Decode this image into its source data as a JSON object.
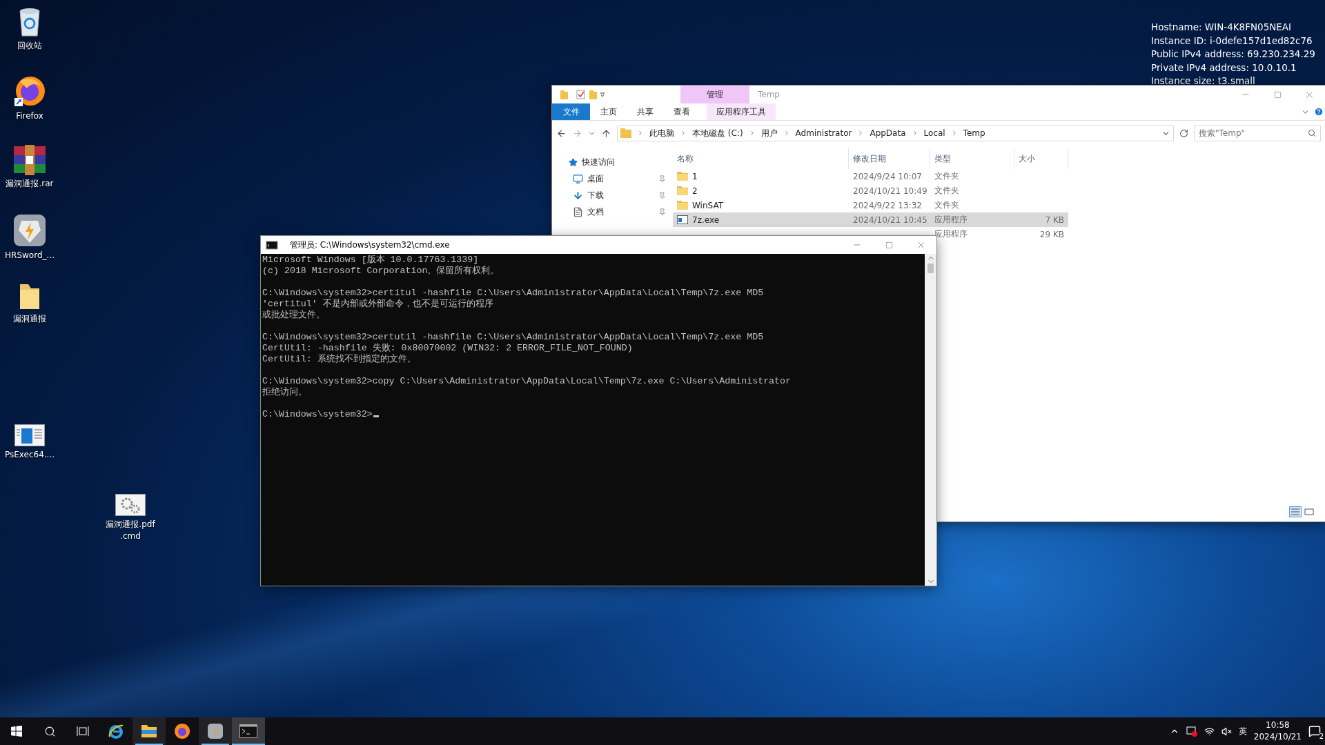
{
  "desktop_icons": [
    {
      "kind": "recycle",
      "label": "回收站"
    },
    {
      "kind": "firefox",
      "label": "Firefox"
    },
    {
      "kind": "rar",
      "label": "漏洞通报.rar"
    },
    {
      "kind": "hrsword",
      "label": "HRSword_..."
    },
    {
      "kind": "folder",
      "label": "漏洞通报"
    },
    {
      "kind": "app",
      "label": "PsExec64...."
    },
    {
      "kind": "script",
      "label": "漏洞通报.pdf .cmd"
    }
  ],
  "instance_info": [
    "Hostname: WIN-4K8FN05NEAI",
    "Instance ID: i-0defe157d1ed82c76",
    "Public IPv4 address: 69.230.234.29",
    "Private IPv4 address: 10.0.10.1",
    "Instance size: t3.small"
  ],
  "explorer": {
    "context_tab": "管理",
    "title": "Temp",
    "ribbon_tabs": [
      {
        "kind": "file",
        "label": "文件"
      },
      {
        "kind": "tab",
        "label": "主页"
      },
      {
        "kind": "tab",
        "label": "共享"
      },
      {
        "kind": "tab",
        "label": "查看"
      },
      {
        "kind": "context",
        "label": "应用程序工具"
      }
    ],
    "breadcrumbs": [
      "此电脑",
      "本地磁盘 (C:)",
      "用户",
      "Administrator",
      "AppData",
      "Local",
      "Temp"
    ],
    "search": {
      "placeholder": "搜索\"Temp\""
    },
    "nav": [
      {
        "kind": "star",
        "label": "快速访问"
      },
      {
        "kind": "desktop",
        "label": "桌面",
        "pinned": true
      },
      {
        "kind": "download",
        "label": "下载",
        "pinned": true
      },
      {
        "kind": "docs",
        "label": "文档",
        "pinned": true
      }
    ],
    "columns": [
      "名称",
      "修改日期",
      "类型",
      "大小"
    ],
    "rows": [
      {
        "kind": "folder",
        "name": "1",
        "date": "2024/9/24 10:07",
        "type": "文件夹",
        "selected": false
      },
      {
        "kind": "folder",
        "name": "2",
        "date": "2024/10/21 10:49",
        "type": "文件夹",
        "selected": false
      },
      {
        "kind": "folder",
        "name": "WinSAT",
        "date": "2024/9/22 13:32",
        "type": "文件夹",
        "selected": false
      },
      {
        "kind": "exe",
        "name": "7z.exe",
        "date": "2024/10/21 10:45",
        "type": "应用程序",
        "size": "7 KB",
        "selected": true
      },
      {
        "kind": "hidden",
        "type": "应用程序",
        "size": "29 KB",
        "selected": false
      }
    ]
  },
  "console": {
    "title": "管理员: C:\\Windows\\system32\\cmd.exe",
    "blocks": [
      [
        "Microsoft Windows [版本 10.0.17763.1339]",
        "(c) 2018 Microsoft Corporation。保留所有权利。"
      ],
      [
        "C:\\Windows\\system32>certitul -hashfile C:\\Users\\Administrator\\AppData\\Local\\Temp\\7z.exe MD5",
        "'certitul' 不是内部或外部命令，也不是可运行的程序",
        "或批处理文件。"
      ],
      [
        "C:\\Windows\\system32>certutil -hashfile C:\\Users\\Administrator\\AppData\\Local\\Temp\\7z.exe MD5",
        "CertUtil: -hashfile 失败: 0x80070002 (WIN32: 2 ERROR_FILE_NOT_FOUND)",
        "CertUtil: 系统找不到指定的文件。"
      ],
      [
        "C:\\Windows\\system32>copy C:\\Users\\Administrator\\AppData\\Local\\Temp\\7z.exe C:\\Users\\Administrator",
        "拒绝访问。"
      ]
    ],
    "prompt": "C:\\Windows\\system32>"
  },
  "taskbar": {
    "apps": [
      {
        "kind": "ie",
        "running": false,
        "selected": false
      },
      {
        "kind": "explorer",
        "running": true,
        "selected": false
      },
      {
        "kind": "firefox",
        "running": false,
        "selected": false
      },
      {
        "kind": "hrsword",
        "running": true,
        "selected": false
      },
      {
        "kind": "cmd",
        "running": true,
        "selected": true
      }
    ],
    "ime": "英",
    "time": "10:58",
    "date": "2024/10/21",
    "notifications": "2"
  }
}
